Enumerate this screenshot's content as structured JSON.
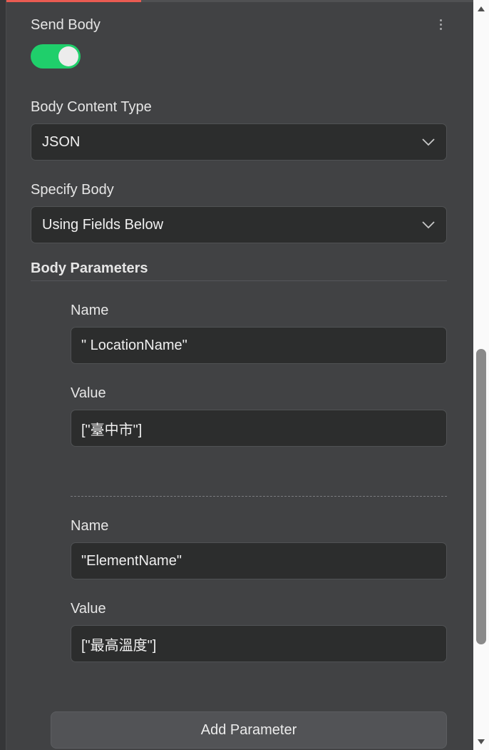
{
  "send_body": {
    "label": "Send Body",
    "enabled": true
  },
  "body_content_type": {
    "label": "Body Content Type",
    "selected": "JSON"
  },
  "specify_body": {
    "label": "Specify Body",
    "selected": "Using Fields Below"
  },
  "body_parameters": {
    "title": "Body Parameters",
    "items": [
      {
        "name_label": "Name",
        "name_value": "\" LocationName\"",
        "value_label": "Value",
        "value_value": "[\"臺中市\"]"
      },
      {
        "name_label": "Name",
        "name_value": "\"ElementName\"",
        "value_label": "Value",
        "value_value": "[\"最高溫度\"]"
      }
    ],
    "add_label": "Add Parameter"
  },
  "colors": {
    "accent": "#ea5b52",
    "toggle_on": "#1fcf6b",
    "panel_bg": "#414244",
    "field_bg": "#2c2d2d"
  },
  "icons": {
    "more": "more-vertical-icon",
    "chevron": "chevron-down-icon"
  }
}
